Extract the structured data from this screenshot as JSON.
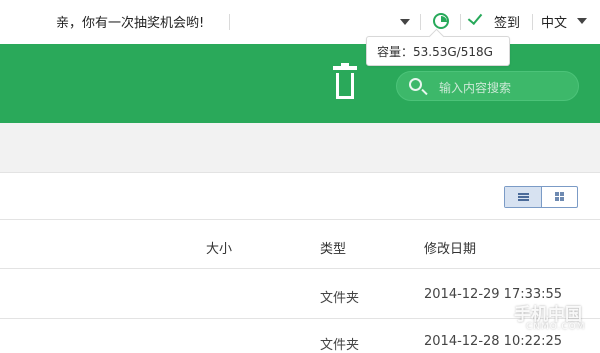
{
  "topbar": {
    "promo_text": "亲，你有一次抽奖机会哟!",
    "signin_label": "签到",
    "language_label": "中文"
  },
  "tooltip": {
    "capacity_text": "容量：53.53G/518G"
  },
  "search": {
    "placeholder": "输入内容搜索"
  },
  "table": {
    "headers": {
      "size": "大小",
      "type": "类型",
      "modified": "修改日期"
    },
    "rows": [
      {
        "type": "文件夹",
        "modified": "2014-12-29 17:33:55"
      },
      {
        "type": "文件夹",
        "modified": "2014-12-28 10:22:25"
      }
    ]
  },
  "watermark": {
    "line1": "手机中国",
    "line2": "CNMO.COM"
  },
  "colors": {
    "brand_green": "#2aa95a",
    "toggle_blue": "#7b9bc6"
  },
  "icons": [
    "dropdown-icon",
    "storage-pie-icon",
    "checkmark-icon",
    "trash-icon",
    "search-icon",
    "list-view-icon",
    "grid-view-icon"
  ]
}
